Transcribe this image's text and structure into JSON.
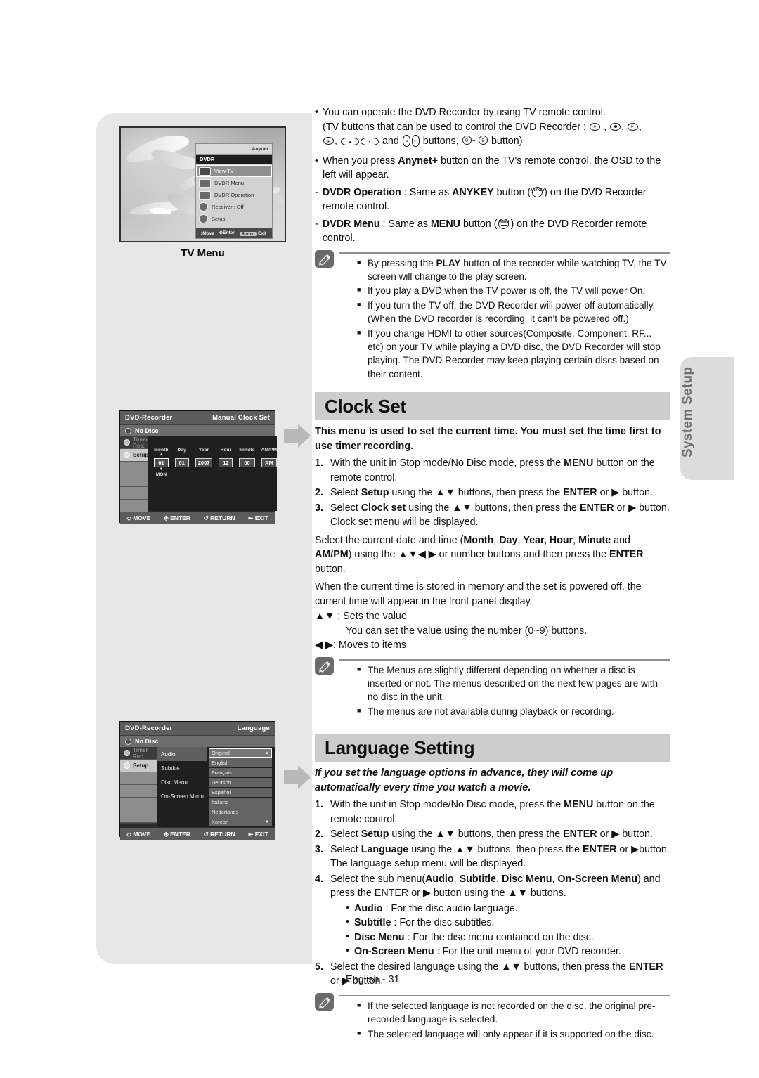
{
  "page": {
    "footer": "English - 31",
    "side_tab": "System Setup"
  },
  "figures": {
    "tv_menu": {
      "caption": "TV Menu",
      "brand": "Anynet",
      "header": "DVDR",
      "items": [
        {
          "label": "View TV",
          "selected": true
        },
        {
          "label": "DVDR Menu",
          "selected": false
        },
        {
          "label": "DVDR Operation",
          "selected": false
        },
        {
          "label": "Receiver :     Off",
          "selected": false
        },
        {
          "label": "Setup",
          "selected": false
        }
      ],
      "bar": {
        "move": "Move",
        "enter": "Enter",
        "exit": "Exit",
        "chip": "Anynet"
      }
    },
    "clock_set": {
      "title_left": "DVD-Recorder",
      "title_right": "Manual Clock Set",
      "disc_status": "No Disc",
      "side_items": [
        {
          "label": "Timer Rec.",
          "state": "dim"
        },
        {
          "label": "Setup",
          "state": "selected"
        }
      ],
      "fields": [
        {
          "label": "Month",
          "value": "01",
          "active": true
        },
        {
          "label": "Day",
          "value": "01",
          "active": false
        },
        {
          "label": "Year",
          "value": "2007",
          "active": false
        },
        {
          "label": "Hour",
          "value": "12",
          "active": false
        },
        {
          "label": "Minute",
          "value": "00",
          "active": false
        },
        {
          "label": "AM/PM",
          "value": "AM",
          "active": false
        }
      ],
      "day_of_week": "MON",
      "footer": [
        "MOVE",
        "ENTER",
        "RETURN",
        "EXIT"
      ]
    },
    "language": {
      "title_left": "DVD-Recorder",
      "title_right": "Language",
      "disc_status": "No Disc",
      "side_items": [
        {
          "label": "Timer Rec.",
          "state": "dim"
        },
        {
          "label": "Setup",
          "state": "selected"
        }
      ],
      "menu": [
        {
          "label": "Audio",
          "selected": true
        },
        {
          "label": "Subtitle",
          "selected": false
        },
        {
          "label": "Disc Menu",
          "selected": false
        },
        {
          "label": "On-Screen Menu",
          "selected": false
        }
      ],
      "options": [
        {
          "label": "Original",
          "arrow": "▲",
          "highlight": true
        },
        {
          "label": "English",
          "arrow": "",
          "highlight": false
        },
        {
          "label": "Français",
          "arrow": "",
          "highlight": false
        },
        {
          "label": "Deutsch",
          "arrow": "",
          "highlight": false
        },
        {
          "label": "Español",
          "arrow": "",
          "highlight": false
        },
        {
          "label": "Italiano",
          "arrow": "",
          "highlight": false
        },
        {
          "label": "Nederlands",
          "arrow": "",
          "highlight": false
        },
        {
          "label": "Korean",
          "arrow": "▼",
          "highlight": false
        }
      ],
      "footer": [
        "MOVE",
        "ENTER",
        "RETURN",
        "EXIT"
      ]
    }
  },
  "intro": {
    "b1_line1": "You can operate the DVD Recorder by using TV remote control.",
    "b1_line2_a": "(TV buttons that can be used to control the DVD Recorder : ",
    "b1_line3_a": " and ",
    "b1_line3_b": " buttons, ",
    "b1_line3_c": " button)",
    "b2_a": "When you press ",
    "b2_bold": "Anynet+",
    "b2_b": " button on the TV's remote control, the OSD to the left will appear.",
    "sub1_bold": "DVDR Operation",
    "sub1_a": " : Same as ",
    "sub1_bold2": "ANYKEY",
    "sub1_b": " button (",
    "sub1_c": ") on the DVD Recorder remote control.",
    "sub1_keylabel": "ANYKEY",
    "sub2_bold": "DVDR Menu",
    "sub2_a": " : Same as ",
    "sub2_bold2": "MENU",
    "sub2_b": " button (",
    "sub2_c": ") on the DVD Recorder remote control.",
    "sub2_keylabel": "MENU"
  },
  "note1": {
    "items": [
      "By pressing the PLAY button of the recorder while watching TV, the TV screen will change to the play screen.",
      "If you play a DVD when the TV power is off, the TV will power On.",
      "If you turn the TV off,  the DVD Recorder will power off automatically. (When the DVD recorder is recording, it can't be powered off.)",
      "If you change HDMI to other sources(Composite, Component, RF... etc) on your TV while playing a DVD disc, the DVD Recorder will stop playing. The DVD Recorder may keep playing certain discs based on their content."
    ],
    "item1_pre": "By pressing the ",
    "item1_bold": "PLAY",
    "item1_post": " button of the recorder while watching TV, the TV screen will change to the play screen."
  },
  "clock_section": {
    "heading": "Clock Set",
    "intro": "This menu is used to set the current time. You must set the time first to use timer recording.",
    "steps": [
      {
        "num": "1.",
        "pre": "With the unit in Stop mode/No Disc mode, press the ",
        "bold": "MENU",
        "post": " button on the remote control."
      },
      {
        "num": "2.",
        "pre": "Select ",
        "bold": "Setup",
        "mid": " using the ",
        "arrows": "▲▼",
        "mid2": " buttons, then press the ",
        "bold2": "ENTER",
        "post": " or ▶ button."
      },
      {
        "num": "3.",
        "pre": "Select ",
        "bold": "Clock set",
        "mid": " using the ",
        "arrows": "▲▼",
        "mid2": " buttons, then press the ",
        "bold2": "ENTER",
        "post": " or ▶ button. Clock set  menu will be displayed."
      }
    ],
    "para1_a": "Select the current date and time (",
    "para1_b1": "Month",
    "para1_b2": "Day",
    "para1_b3": "Year, Hour",
    "para1_b4": "Minute",
    "para1_b5": "AM/PM",
    "para1_c": ") using the ",
    "para1_arrows": "▲▼◀ ▶",
    "para1_d": " or number buttons and then press the ",
    "para1_e": "ENTER",
    "para1_f": " button.",
    "para2": "When the current time is stored in memory and the set is powered off, the current time will appear in the front panel display.",
    "key_updown": "▲▼",
    "key_updown_desc": " : Sets the value",
    "key_updown_desc2": "You can set the value using the number (0~9) buttons.",
    "key_leftright": "◀ ▶",
    "key_leftright_desc": ": Moves to items"
  },
  "note2": {
    "items": [
      "The Menus are slightly different depending on whether a disc is inserted or not. The menus described on the next few pages are with no disc in the unit.",
      "The menus are not available during playback or recording."
    ]
  },
  "language_section": {
    "heading": "Language Setting",
    "intro": "If you set the language options in advance, they will come up automatically every time you watch a movie.",
    "steps": [
      {
        "num": "1.",
        "pre": "With the unit in Stop mode/No Disc mode, press the ",
        "bold": "MENU",
        "post": " button on the remote control."
      },
      {
        "num": "2.",
        "pre": "Select ",
        "bold": "Setup",
        "mid": " using the ",
        "arrows": "▲▼",
        "mid2": " buttons, then press the ",
        "bold2": "ENTER",
        "post": " or ▶ button."
      },
      {
        "num": "3.",
        "pre": "Select ",
        "bold": "Language",
        "mid": " using the ",
        "arrows": "▲▼",
        "mid2": " buttons, then press the ",
        "bold2": "ENTER",
        "post": " or ▶button. The language setup menu will be displayed."
      },
      {
        "num": "4.",
        "pre": "Select the sub menu(",
        "bold_a": "Audio",
        "bold_b": "Subtitle",
        "bold_c": "Disc Menu",
        "bold_d": "On-Screen Menu",
        "post": ") and press the ENTER or ▶ button using the ▲▼ buttons."
      },
      {
        "num": "5.",
        "pre": "Select the desired language using the ",
        "arrows": "▲▼",
        "mid": " buttons, then press the ",
        "bold2": "ENTER",
        "post": " or ▶ button."
      }
    ],
    "submenu_desc": [
      {
        "term": "Audio",
        "desc": " : For the disc audio language."
      },
      {
        "term": "Subtitle",
        "desc": " : For the disc subtitles."
      },
      {
        "term": "Disc Menu",
        "desc": " : For the disc menu contained on the disc."
      },
      {
        "term": "On-Screen Menu",
        "desc": " : For the unit menu of your DVD recorder."
      }
    ]
  },
  "note3": {
    "items": [
      "If the selected language is not recorded on the disc, the original pre-recorded language is selected.",
      "The selected language will only appear if it is supported on the disc."
    ]
  }
}
